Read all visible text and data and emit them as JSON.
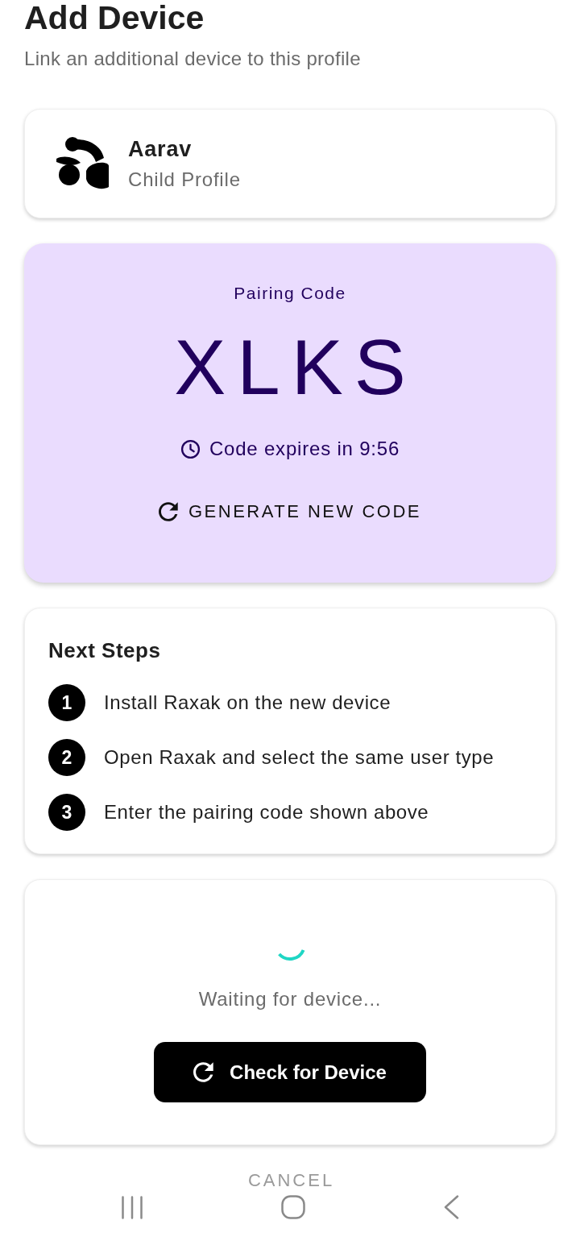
{
  "header": {
    "title": "Add Device",
    "subtitle": "Link an additional device to this profile"
  },
  "profile": {
    "name": "Aarav",
    "type": "Child Profile"
  },
  "pairing": {
    "label": "Pairing Code",
    "code": "XLKS",
    "expiry": "Code expires in 9:56",
    "action": "GENERATE NEW CODE"
  },
  "next_steps": {
    "title": "Next Steps",
    "steps": [
      {
        "number": "1",
        "text": "Install Raxak on the new device"
      },
      {
        "number": "2",
        "text": "Open Raxak and select the same user type"
      },
      {
        "number": "3",
        "text": "Enter the pairing code shown above"
      }
    ]
  },
  "waiting": {
    "status": "Waiting for device...",
    "button": "Check for Device"
  },
  "cancel": "CANCEL"
}
